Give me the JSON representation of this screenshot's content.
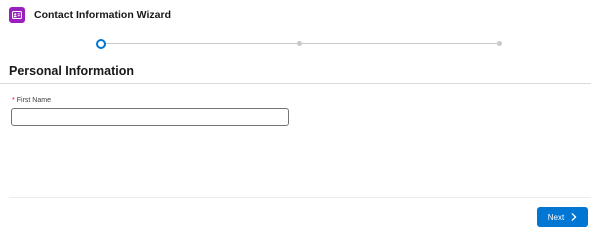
{
  "header": {
    "title": "Contact Information Wizard",
    "icon": "contact-card-icon",
    "icon_color": "#9b1fbd"
  },
  "progress": {
    "steps": 3,
    "current_step": 1,
    "active_color": "#0176d3"
  },
  "section": {
    "title": "Personal Information"
  },
  "form": {
    "first_name": {
      "required_marker": "*",
      "label": "First Name",
      "value": "",
      "placeholder": ""
    }
  },
  "footer": {
    "next_label": "Next",
    "next_icon": "chevron-right-icon",
    "button_color": "#0176d3"
  }
}
